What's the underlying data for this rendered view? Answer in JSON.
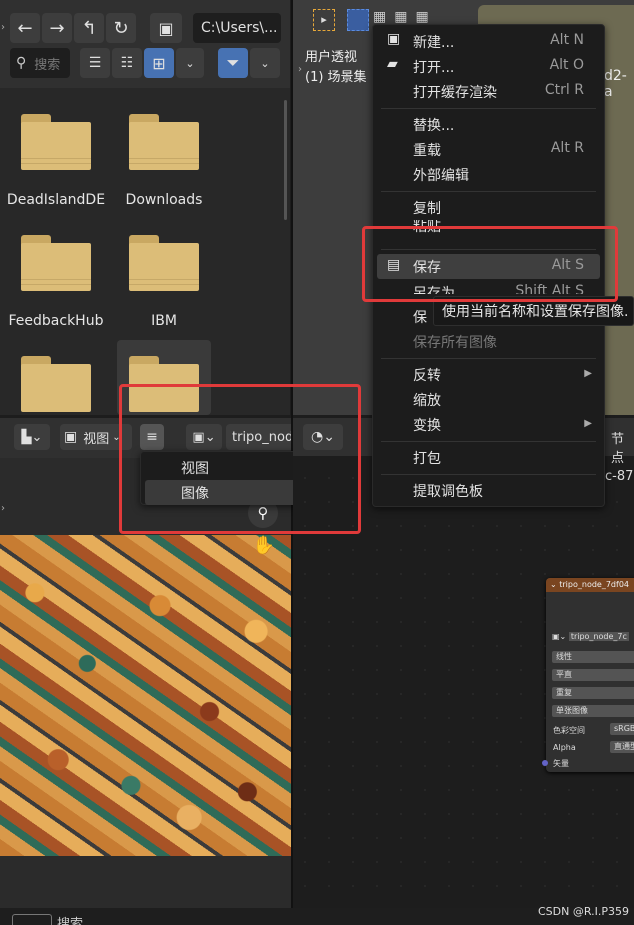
{
  "file_browser": {
    "path": "C:\\Users\\...",
    "search_placeholder": "搜索",
    "folders": [
      "DeadIslandDE",
      "Downloads",
      "FeedbackHub",
      "IBM"
    ]
  },
  "viewport": {
    "line1": "用户透视",
    "line2": "(1) 场景集",
    "obj_suffix": "d2-a"
  },
  "image_editor": {
    "view_label": "视图",
    "image_name": "tripo_nod",
    "submenu": {
      "view": "视图",
      "image": "图像"
    }
  },
  "node_editor": {
    "header_right": "节点",
    "id_fragment": "c-87",
    "node": {
      "title": "tripo_node_7df04",
      "image_name": "tripo_node_7c",
      "rows": [
        "线性",
        "平直",
        "重复",
        "单张图像"
      ],
      "color_space_label": "色彩空间",
      "color_space_value": "sRGB",
      "alpha_label": "Alpha",
      "alpha_value": "直通型",
      "vector_label": "矢量"
    }
  },
  "image_menu": {
    "items": [
      {
        "label": "新建...",
        "shortcut": "Alt N",
        "icon": "new-image-icon"
      },
      {
        "label": "打开...",
        "shortcut": "Alt O",
        "icon": "folder-icon"
      },
      {
        "label": "打开缓存渲染",
        "shortcut": "Ctrl R"
      },
      {
        "label": "替换...",
        "shortcut": ""
      },
      {
        "label": "重载",
        "shortcut": "Alt R"
      },
      {
        "label": "外部编辑",
        "shortcut": ""
      },
      {
        "label": "复制",
        "shortcut": ""
      },
      {
        "label": "粘贴",
        "shortcut": ""
      },
      {
        "label": "保存",
        "shortcut": "Alt S",
        "icon": "save-icon"
      },
      {
        "label": "另存为",
        "shortcut": "Shift Alt S"
      },
      {
        "label": "保",
        "shortcut": ""
      },
      {
        "label": "保存所有图像",
        "shortcut": ""
      },
      {
        "label": "反转",
        "shortcut": ""
      },
      {
        "label": "缩放",
        "shortcut": ""
      },
      {
        "label": "变换",
        "shortcut": ""
      },
      {
        "label": "打包",
        "shortcut": ""
      },
      {
        "label": "提取调色板",
        "shortcut": ""
      }
    ],
    "tooltip": "使用当前名称和设置保存图像."
  },
  "status_bar": {
    "search": "搜索",
    "watermark": "CSDN @R.I.P359"
  },
  "colors": {
    "highlight_red": "#e03a3a",
    "filter_blue": "#4772b3",
    "folder_tan": "#dcbd78"
  }
}
